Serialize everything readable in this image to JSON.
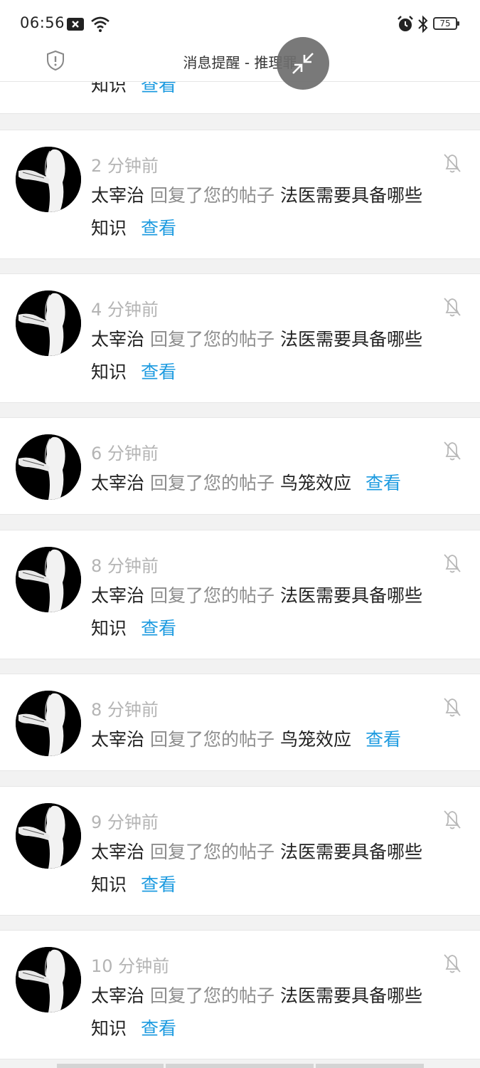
{
  "status_bar": {
    "time": "06:56",
    "battery": "75",
    "icons": [
      "notification-x-icon",
      "wifi-icon",
      "alarm-icon",
      "bluetooth-icon",
      "battery-icon"
    ]
  },
  "header": {
    "title": "消息提醒 - 推理罪",
    "left_icon": "shield-alert-icon",
    "floating_button_icon": "collapse-arrows-icon"
  },
  "partial_item": {
    "post": "知识",
    "view_label": "查看"
  },
  "notifications": [
    {
      "time": "2 分钟前",
      "user": "太宰治",
      "action": "回复了您的帖子",
      "post_line1": "法医需要具备哪些",
      "post_line2": "知识",
      "view_label": "查看"
    },
    {
      "time": "4 分钟前",
      "user": "太宰治",
      "action": "回复了您的帖子",
      "post_line1": "法医需要具备哪些",
      "post_line2": "知识",
      "view_label": "查看"
    },
    {
      "time": "6 分钟前",
      "user": "太宰治",
      "action": "回复了您的帖子",
      "post_line1": "鸟笼效应",
      "post_line2": "",
      "view_label": "查看"
    },
    {
      "time": "8 分钟前",
      "user": "太宰治",
      "action": "回复了您的帖子",
      "post_line1": "法医需要具备哪些",
      "post_line2": "知识",
      "view_label": "查看"
    },
    {
      "time": "8 分钟前",
      "user": "太宰治",
      "action": "回复了您的帖子",
      "post_line1": "鸟笼效应",
      "post_line2": "",
      "view_label": "查看"
    },
    {
      "time": "9 分钟前",
      "user": "太宰治",
      "action": "回复了您的帖子",
      "post_line1": "法医需要具备哪些",
      "post_line2": "知识",
      "view_label": "查看"
    },
    {
      "time": "10 分钟前",
      "user": "太宰治",
      "action": "回复了您的帖子",
      "post_line1": "法医需要具备哪些",
      "post_line2": "知识",
      "view_label": "查看"
    }
  ],
  "colors": {
    "link": "#1e9be0",
    "muted_text": "#8d8d8d",
    "time_text": "#b4b4b4",
    "background": "#f2f2f2"
  }
}
